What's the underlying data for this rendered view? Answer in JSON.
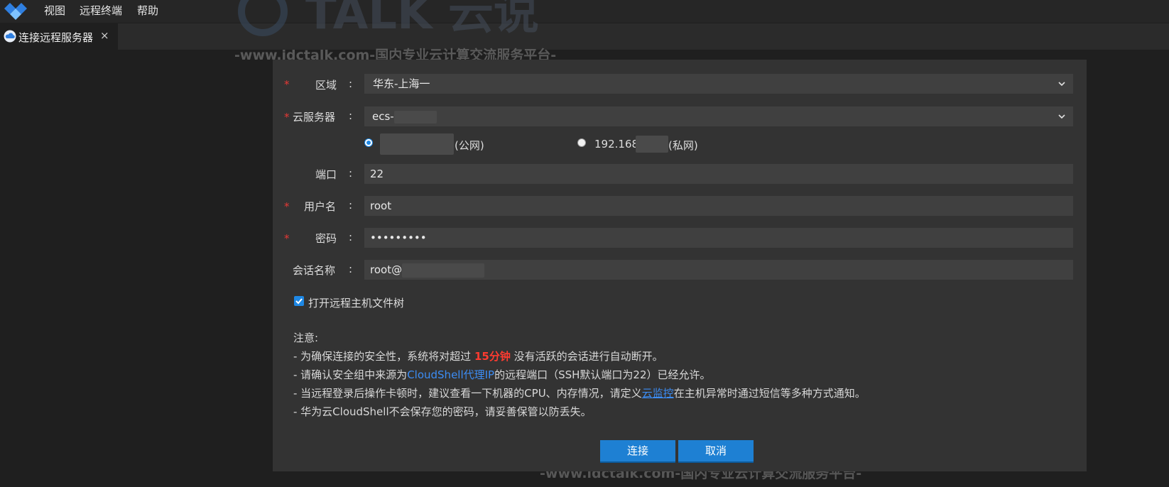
{
  "menubar": {
    "items": [
      "视图",
      "远程终端",
      "帮助"
    ]
  },
  "tab": {
    "label": "连接远程服务器",
    "close": "×"
  },
  "form": {
    "region": {
      "label": "区域",
      "colon": ":",
      "value": "华东-上海一"
    },
    "server": {
      "label": "云服务器",
      "colon": ":",
      "value": "ecs-"
    },
    "ip_options": {
      "public": {
        "suffix": "(公网)",
        "selected": true
      },
      "private": {
        "prefix": "192.168",
        "suffix": "(私网)",
        "selected": false
      }
    },
    "port": {
      "label": "端口",
      "colon": ":",
      "value": "22"
    },
    "username": {
      "label": "用户名",
      "colon": ":",
      "value": "root"
    },
    "password": {
      "label": "密码",
      "colon": ":",
      "value": "•••••••••"
    },
    "session": {
      "label": "会话名称",
      "colon": ":",
      "value": "root@"
    },
    "required_mark": "*",
    "file_tree_checkbox": {
      "label": "打开远程主机文件树",
      "checked": true
    }
  },
  "notes": {
    "title": "注意:",
    "line1": {
      "a": "- 为确保连接的安全性，系统将对超过 ",
      "highlight": "15分钟",
      "b": " 没有活跃的会话进行自动断开。"
    },
    "line2": {
      "a": "- 请确认安全组中来源为",
      "link": "CloudShell代理IP",
      "b": "的远程端口（SSH默认端口为22）已经允许。"
    },
    "line3": {
      "a": "- 当远程登录后操作卡顿时，建议查看一下机器的CPU、内存情况，请定义",
      "link": "云监控",
      "b": "在主机异常时通过短信等多种方式通知。"
    },
    "line4": "- 华为云CloudShell不会保存您的密码，请妥善保管以防丢失。"
  },
  "buttons": {
    "connect": "连接",
    "cancel": "取消"
  },
  "watermark": {
    "brand": "TALK 云说",
    "url": "-www.idctalk.com-国内专业云计算交流服务平台-"
  },
  "colors": {
    "accent": "#1e80d3",
    "required": "#e53935",
    "highlight": "#ff3b30",
    "link": "#3c8df5"
  }
}
